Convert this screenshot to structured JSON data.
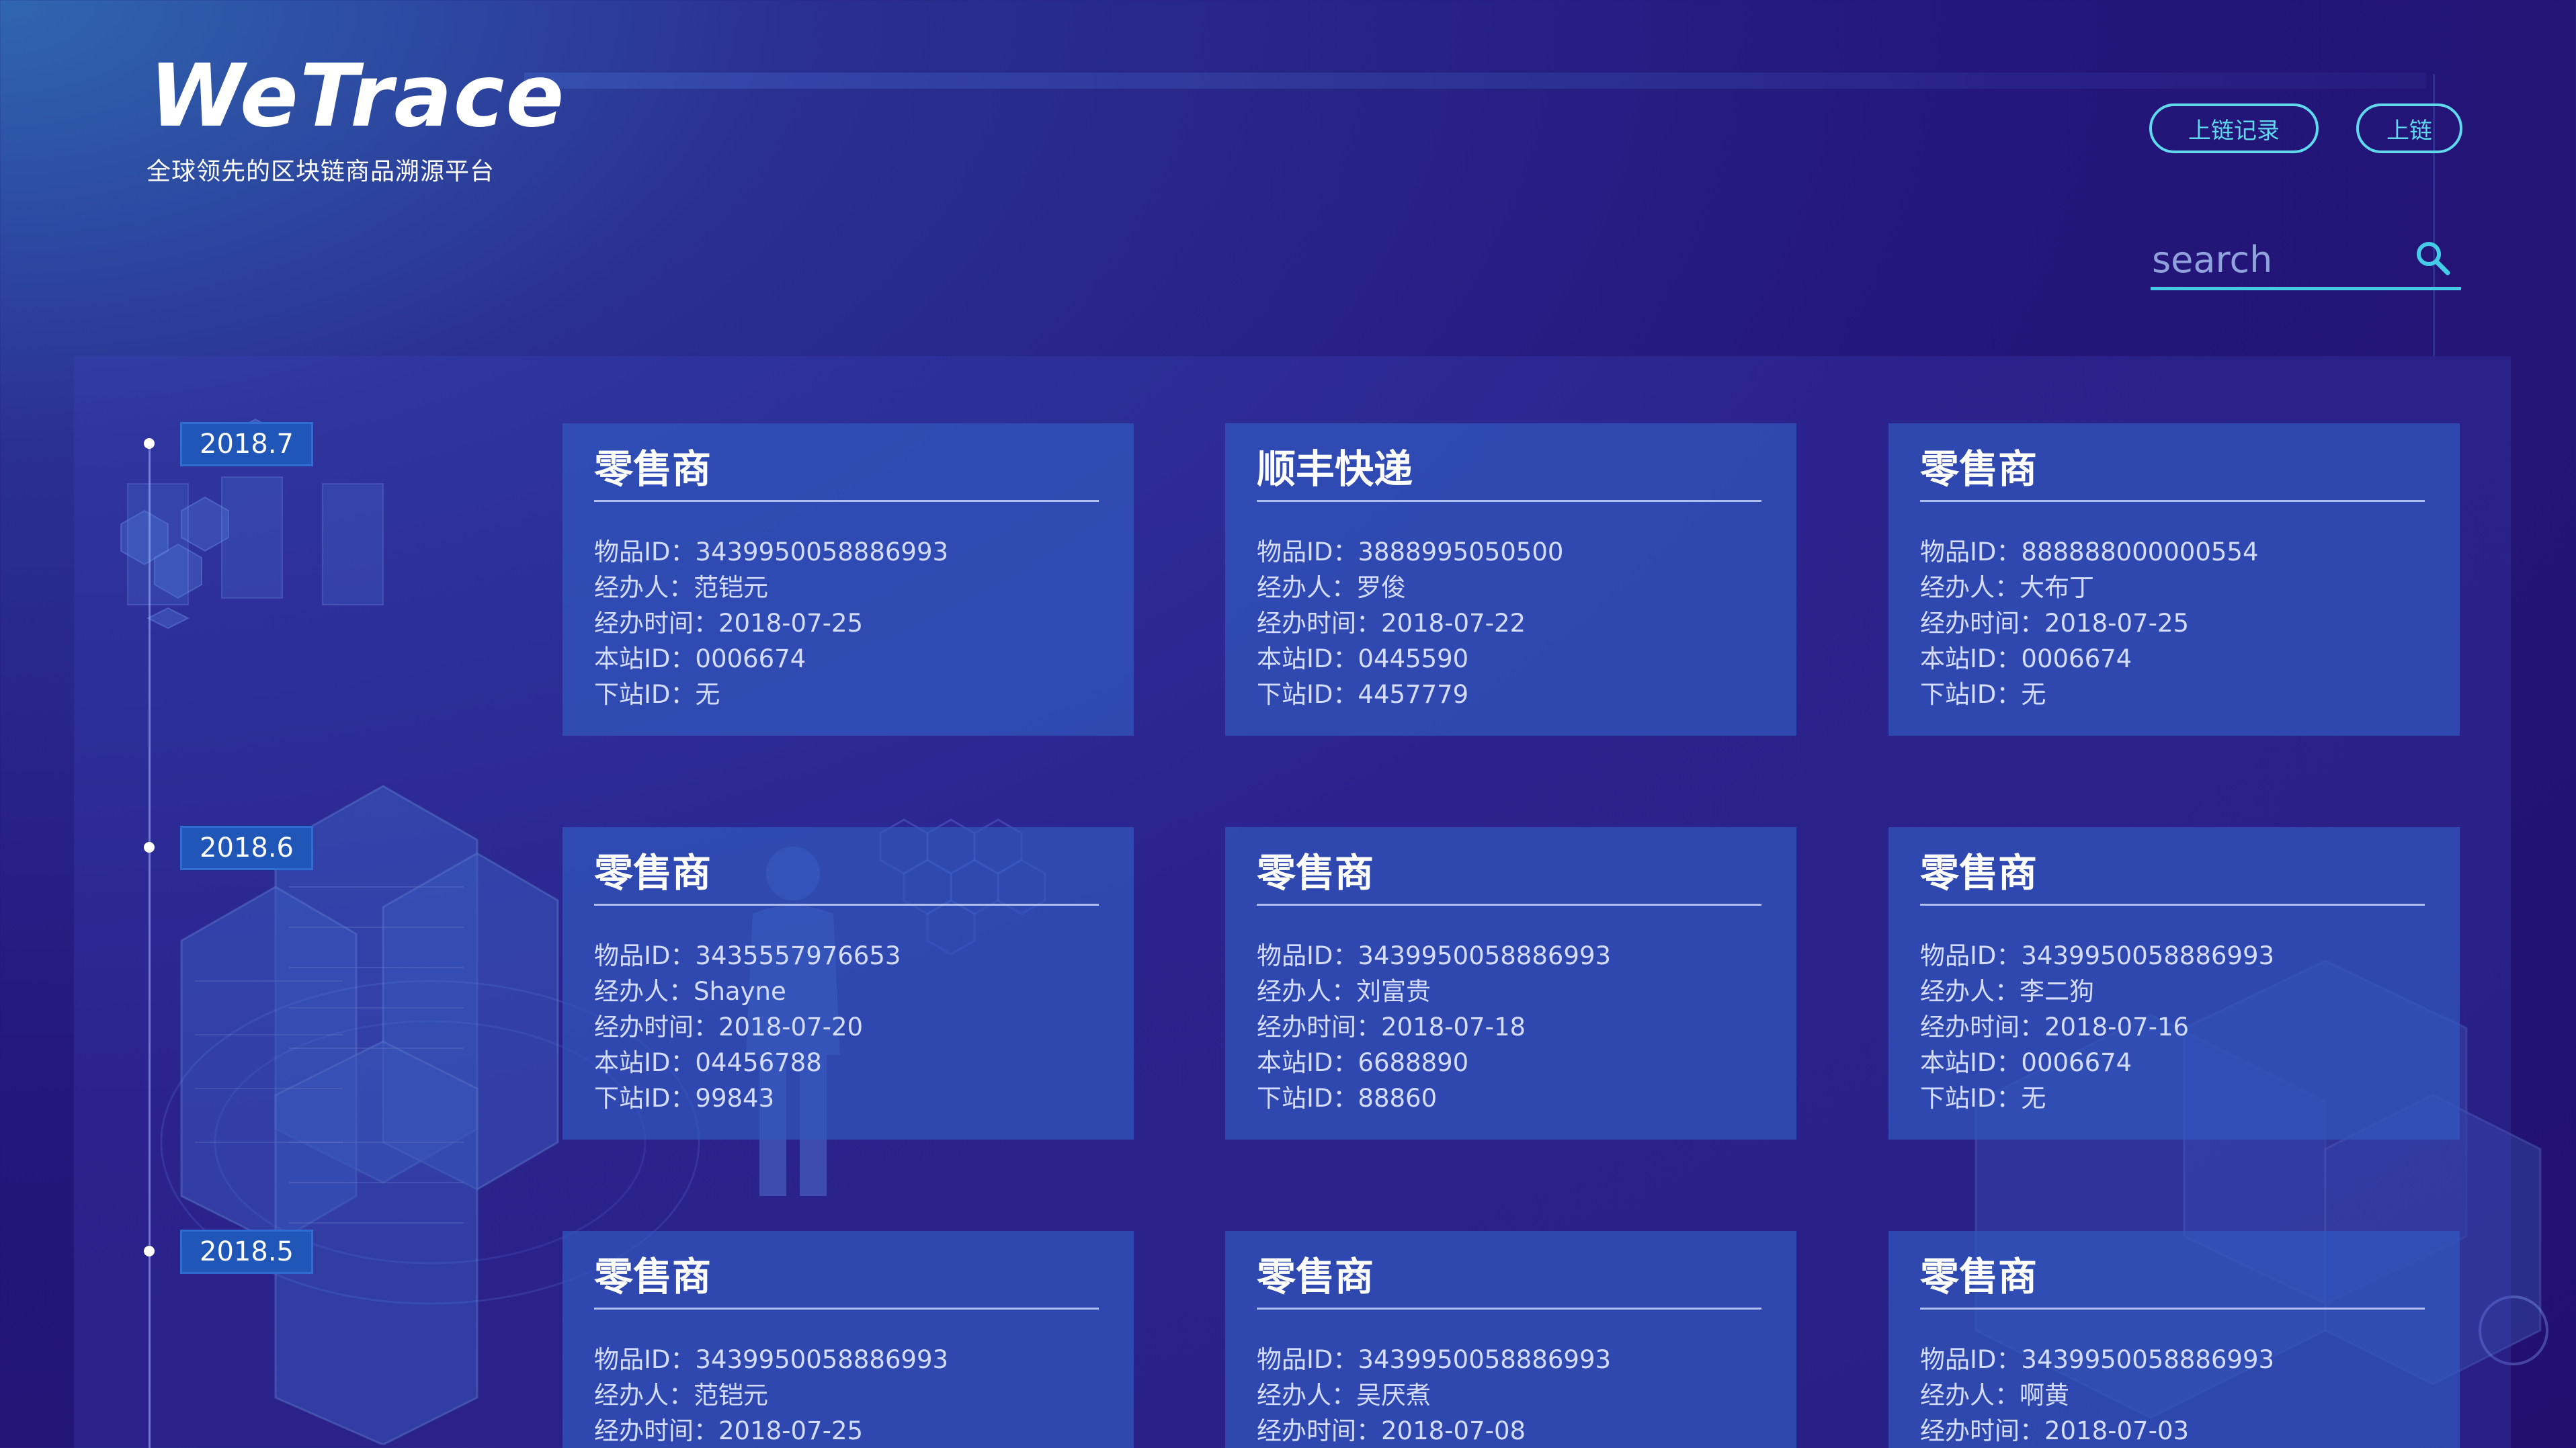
{
  "header": {
    "logo": "WeTrace",
    "tagline": "全球领先的区块链商品溯源平台",
    "records_button": "上链记录",
    "upload_button": "上链",
    "search_placeholder": "search"
  },
  "colors": {
    "accent": "#5fd9ee",
    "background": "#24167a",
    "card": "#3058be",
    "date_label": "#1f56b8"
  },
  "field_labels": {
    "item_id": "物品ID：",
    "handler": "经办人：",
    "time": "经办时间：",
    "station": "本站ID：",
    "next_station": "下站ID："
  },
  "timeline": [
    {
      "date": "2018.7",
      "cards": [
        {
          "title": "零售商",
          "item_id": "3439950058886993",
          "handler": "范铠元",
          "time": "2018-07-25",
          "station": "0006674",
          "next_station": "无"
        },
        {
          "title": "顺丰快递",
          "item_id": "3888995050500",
          "handler": "罗俊",
          "time": "2018-07-22",
          "station": "0445590",
          "next_station": "4457779"
        },
        {
          "title": "零售商",
          "item_id": "888888000000554",
          "handler": "大布丁",
          "time": "2018-07-25",
          "station": "0006674",
          "next_station": "无"
        }
      ]
    },
    {
      "date": "2018.6",
      "cards": [
        {
          "title": "零售商",
          "item_id": "3435557976653",
          "handler": "Shayne",
          "time": "2018-07-20",
          "station": "04456788",
          "next_station": "99843"
        },
        {
          "title": "零售商",
          "item_id": "3439950058886993",
          "handler": "刘富贵",
          "time": "2018-07-18",
          "station": "6688890",
          "next_station": "88860"
        },
        {
          "title": "零售商",
          "item_id": "3439950058886993",
          "handler": "李二狗",
          "time": "2018-07-16",
          "station": "0006674",
          "next_station": "无"
        }
      ]
    },
    {
      "date": "2018.5",
      "cards": [
        {
          "title": "零售商",
          "item_id": "3439950058886993",
          "handler": "范铠元",
          "time": "2018-07-25"
        },
        {
          "title": "零售商",
          "item_id": "3439950058886993",
          "handler": "吴厌煮",
          "time": "2018-07-08"
        },
        {
          "title": "零售商",
          "item_id": "3439950058886993",
          "handler": "啊黄",
          "time": "2018-07-03"
        }
      ]
    }
  ]
}
